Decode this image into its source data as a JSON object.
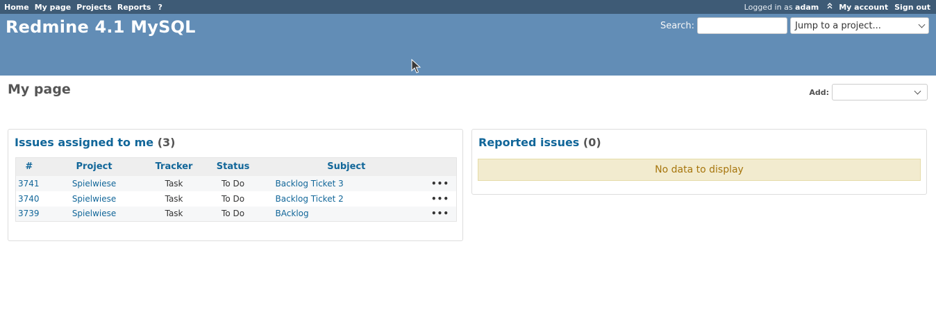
{
  "top_menu": {
    "items": [
      "Home",
      "My page",
      "Projects",
      "Reports"
    ],
    "help": "?",
    "logged_in_label": "Logged in as",
    "user": "adam",
    "my_account": "My account",
    "sign_out": "Sign out"
  },
  "header": {
    "title": "Redmine 4.1 MySQL",
    "search_label": "Search:",
    "search_value": "",
    "jump_placeholder": "Jump to a project..."
  },
  "page": {
    "title": "My page",
    "add_label": "Add:",
    "add_value": ""
  },
  "assigned_box": {
    "title": "Issues assigned to me",
    "count": "(3)",
    "columns": [
      "#",
      "Project",
      "Tracker",
      "Status",
      "Subject"
    ],
    "rows": [
      {
        "id": "3741",
        "project": "Spielwiese",
        "tracker": "Task",
        "status": "To Do",
        "subject": "Backlog Ticket 3"
      },
      {
        "id": "3740",
        "project": "Spielwiese",
        "tracker": "Task",
        "status": "To Do",
        "subject": "Backlog Ticket 2"
      },
      {
        "id": "3739",
        "project": "Spielwiese",
        "tracker": "Task",
        "status": "To Do",
        "subject": "BAcklog"
      }
    ],
    "row_action": "•••"
  },
  "reported_box": {
    "title": "Reported issues",
    "count": "(0)",
    "nodata": "No data to display"
  },
  "colors": {
    "top_menu_bg": "#3e5b76",
    "header_bg": "#628db6",
    "link": "#116699",
    "nodata_bg": "#f2ebcf"
  },
  "icons": {
    "cursor": "mouse-pointer-icon",
    "row_action": "ellipsis-icon",
    "dropdown": "chevron-down-icon",
    "toggle": "double-chevron-up-icon"
  }
}
